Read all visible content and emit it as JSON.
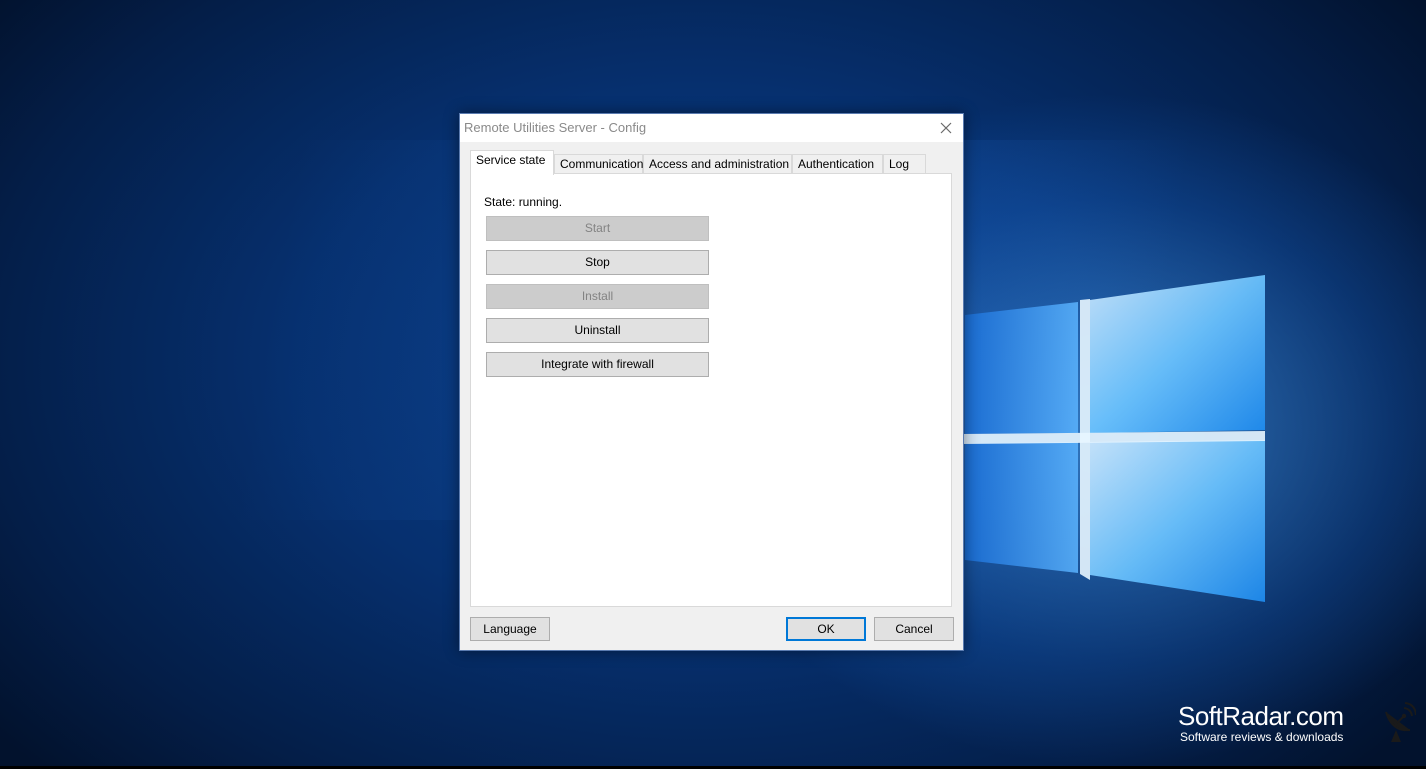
{
  "dialog": {
    "title": "Remote Utilities Server - Config",
    "close_icon": "close-icon"
  },
  "tabs": [
    {
      "label": "Service state",
      "active": true
    },
    {
      "label": "Communication",
      "active": false
    },
    {
      "label": "Access and administration",
      "active": false
    },
    {
      "label": "Authentication",
      "active": false
    },
    {
      "label": "Log",
      "active": false
    }
  ],
  "service_state": {
    "state_text": "State: running.",
    "buttons": [
      {
        "label": "Start",
        "enabled": false
      },
      {
        "label": "Stop",
        "enabled": true
      },
      {
        "label": "Install",
        "enabled": false
      },
      {
        "label": "Uninstall",
        "enabled": true
      },
      {
        "label": "Integrate with firewall",
        "enabled": true
      }
    ]
  },
  "footer": {
    "language_label": "Language",
    "ok_label": "OK",
    "cancel_label": "Cancel"
  },
  "watermark": {
    "title": "SoftRadar.com",
    "subtitle": "Software reviews & downloads",
    "icon": "satellite-dish-icon"
  },
  "colors": {
    "accent": "#0078d7",
    "desktop_blue": "#0a3d86"
  }
}
